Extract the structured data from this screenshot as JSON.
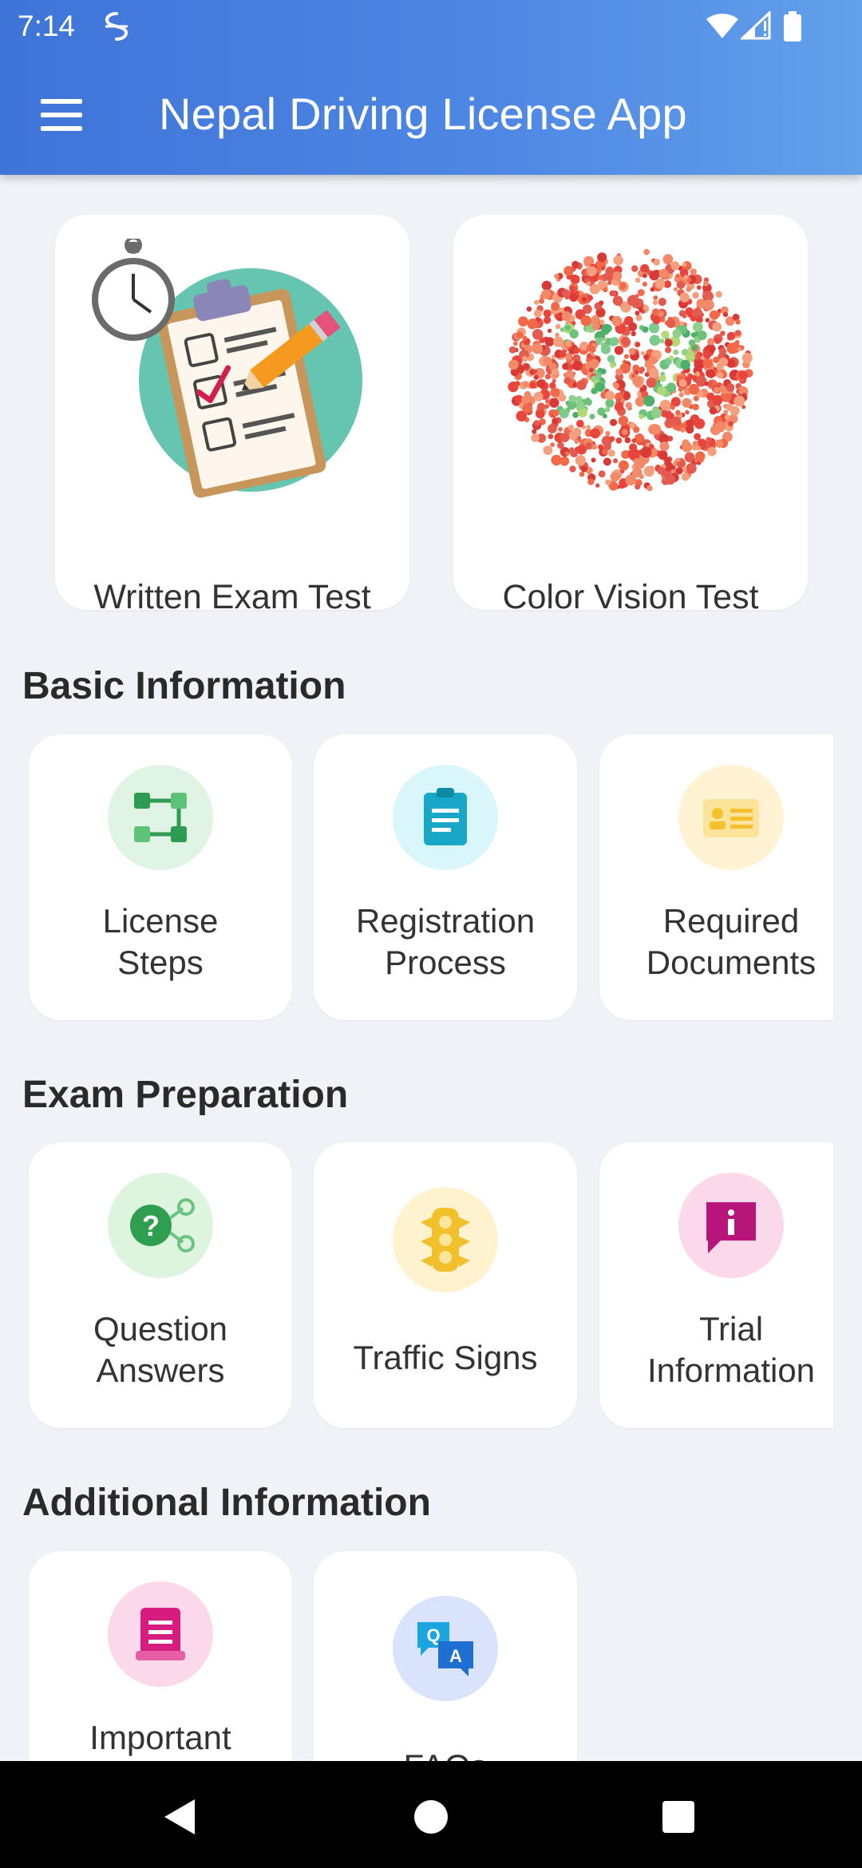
{
  "status_bar": {
    "time": "7:14",
    "icons": [
      "app-notification-icon",
      "wifi-icon",
      "cell-signal-icon",
      "battery-icon"
    ]
  },
  "app_bar": {
    "menu_icon": "hamburger-menu-icon",
    "title": "Nepal Driving License App",
    "gradient": [
      "#3f74d8",
      "#62a0ea"
    ]
  },
  "featured": [
    {
      "label": "Written Exam Test",
      "icon": "exam-clipboard-icon"
    },
    {
      "label": "Color Vision Test",
      "icon": "ishihara-plate-icon"
    }
  ],
  "sections": [
    {
      "title": "Basic Information",
      "items": [
        {
          "label_lines": [
            "License",
            "Steps"
          ],
          "icon": "steps-flow-icon",
          "color": "#2e9b52",
          "bg": "#dff4e2"
        },
        {
          "label_lines": [
            "Registration",
            "Process"
          ],
          "icon": "clipboard-document-icon",
          "color": "#18a7c6",
          "bg": "#d9f7fb"
        },
        {
          "label_lines": [
            "Required",
            "Documents"
          ],
          "icon": "id-card-icon",
          "color": "#f5c02c",
          "bg": "#fff3d3"
        }
      ]
    },
    {
      "title": "Exam Preparation",
      "items": [
        {
          "label_lines": [
            "Question",
            "Answers"
          ],
          "icon": "question-network-icon",
          "color": "#2f9e4e",
          "bg": "#ddf4df"
        },
        {
          "label_lines": [
            "Traffic Signs"
          ],
          "icon": "traffic-light-icon",
          "color": "#f2c02a",
          "bg": "#fff3cf"
        },
        {
          "label_lines": [
            "Trial",
            "Information"
          ],
          "icon": "info-chat-icon",
          "color": "#b8157a",
          "bg": "#fbd9ea"
        }
      ]
    },
    {
      "title": "Additional Information",
      "items": [
        {
          "label_lines": [
            "Important"
          ],
          "icon": "notice-document-icon",
          "color": "#d61c7e",
          "bg": "#fbd9ea"
        },
        {
          "label_lines": [
            "FAQs"
          ],
          "icon": "qa-chat-icon",
          "color": "#1d6fd1",
          "bg": "#d9e3fb"
        }
      ]
    }
  ],
  "nav_bar": {
    "buttons": [
      "back-icon",
      "home-icon",
      "recents-icon"
    ]
  }
}
